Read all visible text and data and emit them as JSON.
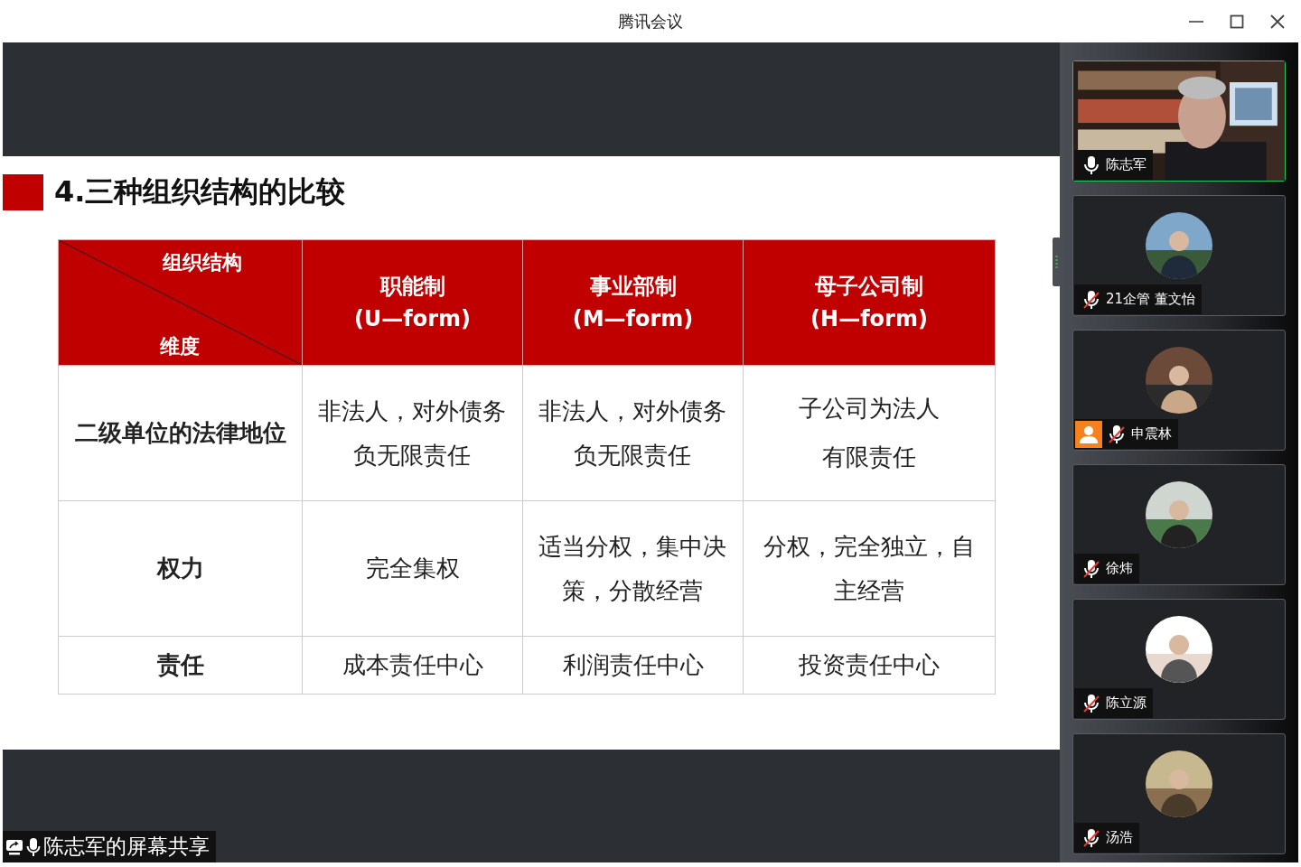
{
  "window": {
    "title": "腾讯会议"
  },
  "slide": {
    "title": "4.三种组织结构的比较",
    "table": {
      "corner": {
        "top": "组织结构",
        "bottom": "维度"
      },
      "columns": [
        {
          "name": "职能制",
          "form": "(U—form)"
        },
        {
          "name": "事业部制",
          "form": "(M—form)"
        },
        {
          "name": "母子公司制",
          "form": "(H—form)"
        }
      ],
      "rows": [
        {
          "header": "二级单位的法律地位",
          "cells": [
            "非法人，对外债务负无限责任",
            "非法人，对外债务负无限责任",
            "子公司为法人有限责任"
          ]
        },
        {
          "header": "权力",
          "cells": [
            "完全集权",
            "适当分权，集中决策，分散经营",
            "分权，完全独立，自主经营"
          ]
        },
        {
          "header": "责任",
          "cells": [
            "成本责任中心",
            "利润责任中心",
            "投资责任中心"
          ]
        }
      ]
    }
  },
  "share_label": "陈志军的屏幕共享",
  "participants": [
    {
      "name": "陈志军",
      "kind": "video",
      "muted": false,
      "speaking": true,
      "badge": false
    },
    {
      "name": "21企管 董文怡",
      "kind": "avatar",
      "muted": true,
      "speaking": false,
      "badge": false
    },
    {
      "name": "申震林",
      "kind": "avatar",
      "muted": true,
      "speaking": false,
      "badge": true
    },
    {
      "name": "徐炜",
      "kind": "avatar",
      "muted": true,
      "speaking": false,
      "badge": false
    },
    {
      "name": "陈立源",
      "kind": "avatar",
      "muted": true,
      "speaking": false,
      "badge": false
    },
    {
      "name": "汤浩",
      "kind": "avatar",
      "muted": true,
      "speaking": false,
      "badge": false
    }
  ]
}
